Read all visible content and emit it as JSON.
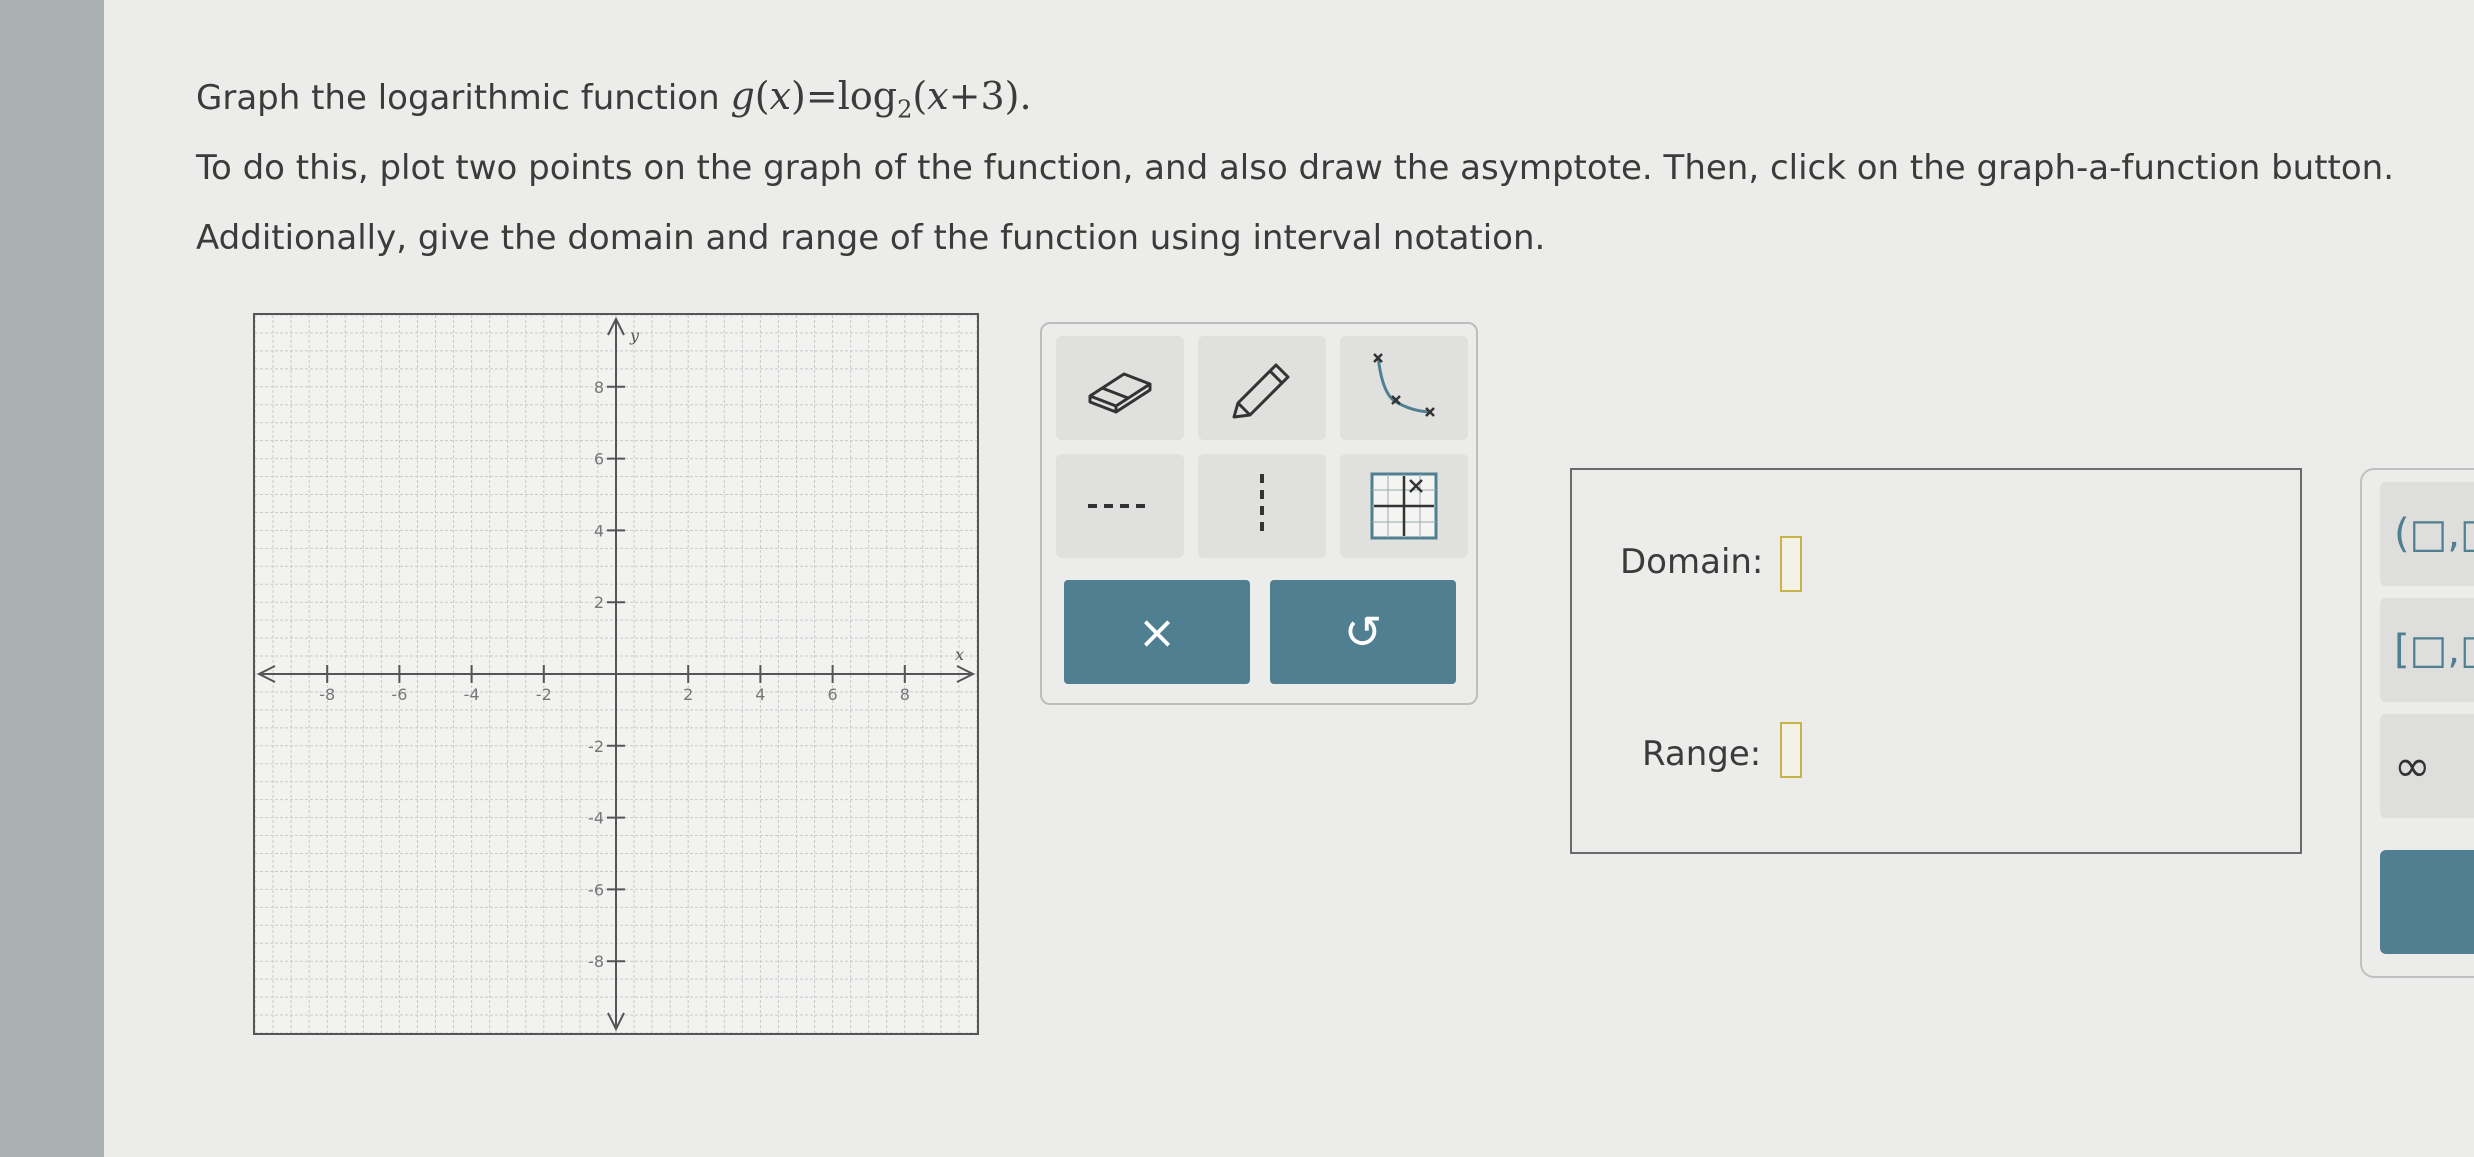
{
  "question": {
    "line1_prefix": "Graph the logarithmic function ",
    "func_name": "g",
    "func_var": "x",
    "equals": "=",
    "log": "log",
    "log_base": "2",
    "log_arg_var": "x",
    "log_arg_rest": "+3",
    "period": ".",
    "line2": "To do this, plot two points on the graph of the function, and also draw the asymptote. Then, click on the graph-a-function button.",
    "line3": "Additionally, give the domain and range of the function using interval notation."
  },
  "graph": {
    "x_axis_label": "x",
    "y_axis_label": "y",
    "x_ticks": [
      "-8",
      "-6",
      "-4",
      "-2",
      "2",
      "4",
      "6",
      "8"
    ],
    "y_ticks": [
      "8",
      "6",
      "4",
      "2",
      "-2",
      "-4",
      "-6",
      "-8"
    ],
    "xlim": [
      -10,
      10
    ],
    "ylim": [
      -10,
      10
    ],
    "grid": true
  },
  "toolbox": {
    "tools": [
      "eraser-icon",
      "pencil-icon",
      "graph-function-icon",
      "dashed-horizontal-line-icon",
      "dashed-vertical-line-icon",
      "graph-grid-icon"
    ],
    "clear_symbol": "×",
    "undo_symbol": "↺"
  },
  "answers": {
    "domain_label": "Domain:",
    "range_label": "Range:",
    "domain_value": "",
    "range_value": ""
  },
  "interval_panel": {
    "open_interval": "(□,□",
    "closed_interval": "[□,□",
    "infinity": "∞",
    "next_symbol": "›"
  },
  "colors": {
    "accent": "#4f7f91",
    "input_border": "#c8b24a"
  }
}
